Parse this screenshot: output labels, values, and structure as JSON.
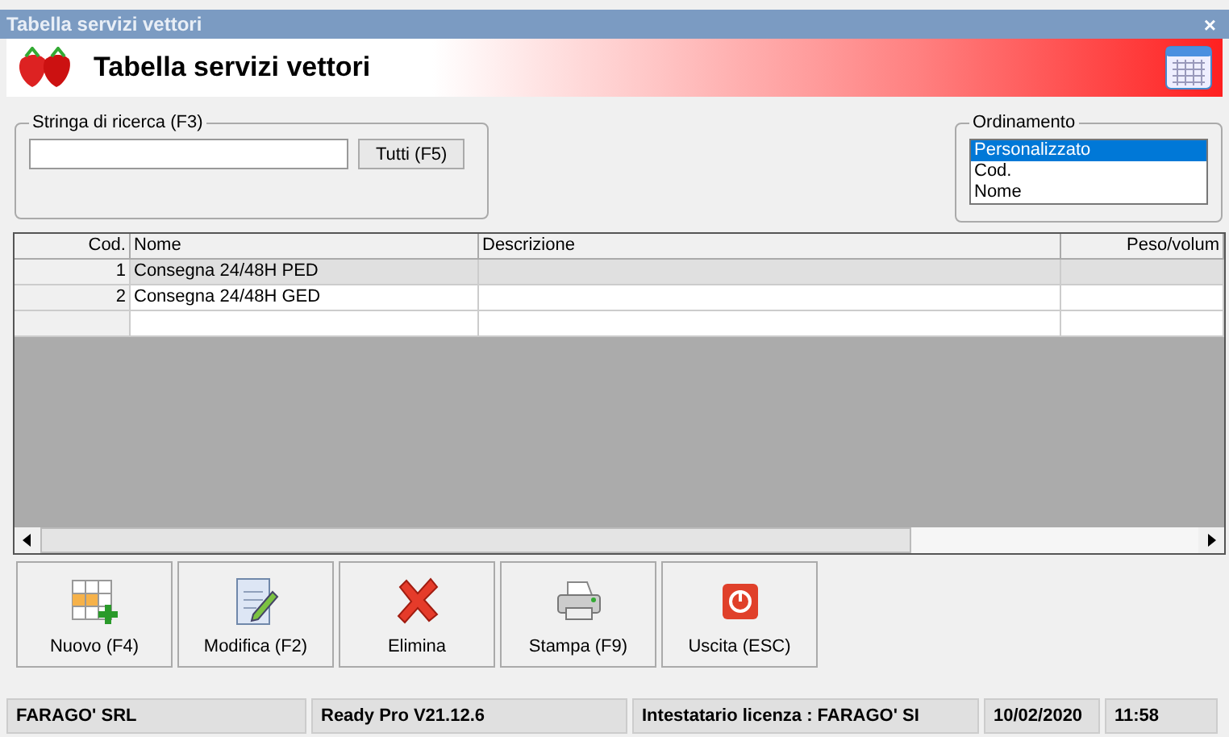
{
  "window": {
    "title": "Tabella servizi vettori",
    "close": "×"
  },
  "header": {
    "title": "Tabella servizi vettori"
  },
  "search": {
    "legend": "Stringa di ricerca (F3)",
    "button": "Tutti (F5)"
  },
  "ordering": {
    "legend": "Ordinamento",
    "options": [
      {
        "label": "Personalizzato",
        "selected": true
      },
      {
        "label": "Cod.",
        "selected": false
      },
      {
        "label": "Nome",
        "selected": false
      }
    ]
  },
  "table": {
    "columns": [
      "Cod.",
      "Nome",
      "Descrizione",
      "Peso/volum"
    ],
    "rows": [
      {
        "cells": [
          "1",
          "Consegna 24/48H PED",
          "",
          ""
        ],
        "selected": true
      },
      {
        "cells": [
          "2",
          "Consegna 24/48H GED",
          "",
          ""
        ],
        "selected": false
      },
      {
        "cells": [
          "",
          "",
          "",
          ""
        ],
        "selected": false
      }
    ]
  },
  "buttons": [
    {
      "label": "Nuovo (F4)",
      "kind": "new"
    },
    {
      "label": "Modifica (F2)",
      "kind": "edit"
    },
    {
      "label": "Elimina",
      "kind": "delete"
    },
    {
      "label": "Stampa (F9)",
      "kind": "print"
    },
    {
      "label": "Uscita (ESC)",
      "kind": "exit"
    }
  ],
  "status_bar": [
    "FARAGO' SRL",
    "Ready Pro V21.12.6",
    "Intestatario licenza : FARAGO' SI",
    "10/02/2020",
    "11:58"
  ]
}
